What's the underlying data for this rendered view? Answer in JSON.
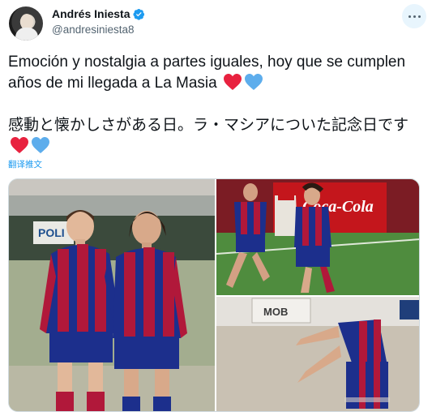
{
  "user": {
    "display_name": "Andrés Iniesta",
    "handle": "@andresiniesta8",
    "avatar_icon": "profile-avatar",
    "verified_icon": "verified-badge-icon"
  },
  "tweet": {
    "text_line1": "Emoción y nostalgia a partes iguales, hoy que se cumplen años de mi llegada a La Masia",
    "text_line2": "感動と懐かしさがある日。ラ・マシアについた記念日です",
    "emojis": [
      "red-heart",
      "blue-heart"
    ],
    "translate_label": "翻译推文"
  },
  "media": {
    "photos": [
      "photo-two-boys-barcelona-kit",
      "photo-youth-football-match",
      "photo-player-close-up"
    ],
    "sign_text": "POLI",
    "banner_text": "Coca-Cola",
    "banner2_text": "MOB"
  },
  "colors": {
    "accent": "#1d9bf0",
    "text": "#0f1419",
    "secondary": "#536471",
    "heart_red": "#e8223f",
    "heart_blue": "#5dadec",
    "barca_blue": "#1c2f8c",
    "barca_red": "#b1183a"
  }
}
